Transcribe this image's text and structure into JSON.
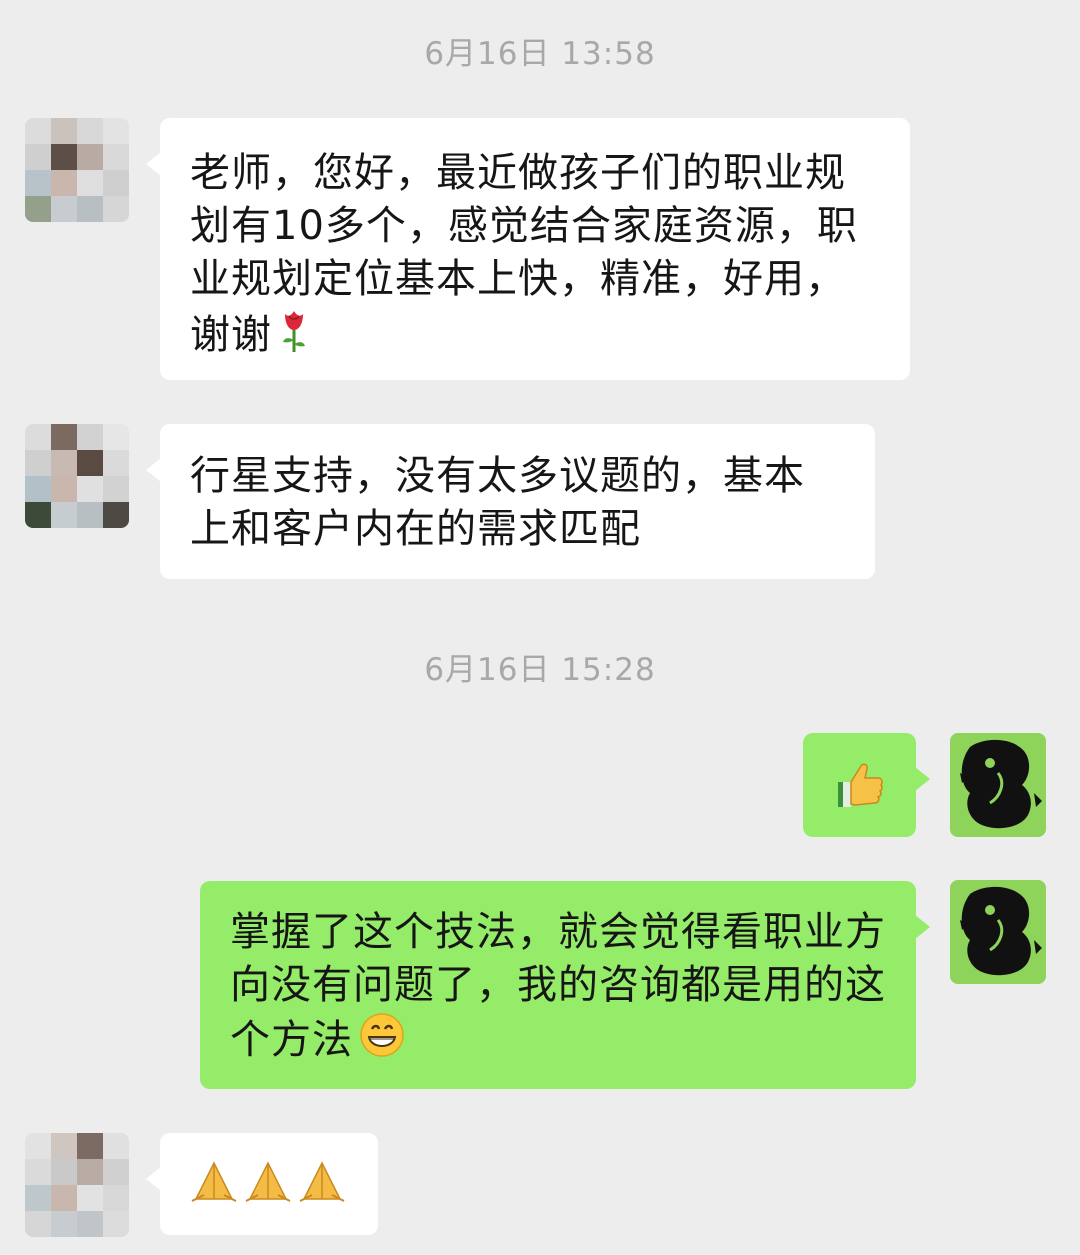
{
  "timestamps": [
    "6月16日 13:58",
    "6月16日 15:28"
  ],
  "messages": [
    {
      "side": "left",
      "text": "老师，您好，最近做孩子们的职业规划有10多个，感觉结合家庭资源，职业规划定位基本上快，精准，好用，谢谢",
      "emoji": "rose-emoji"
    },
    {
      "side": "left",
      "text": "行星支持，没有太多议题的，基本上和客户内在的需求匹配"
    },
    {
      "side": "right",
      "emoji": "thumbs-up-emoji"
    },
    {
      "side": "right",
      "text": "掌握了这个技法，就会觉得看职业方向没有问题了，我的咨询都是用的这个方法",
      "emoji": "grinning-face-emoji"
    },
    {
      "side": "left",
      "emoji": "folded-hands-emoji",
      "emoji_count": 3
    }
  ],
  "colors": {
    "background": "#ededed",
    "incoming_bubble": "#ffffff",
    "outgoing_bubble": "#95ec69",
    "timestamp": "#a8a8a8"
  }
}
